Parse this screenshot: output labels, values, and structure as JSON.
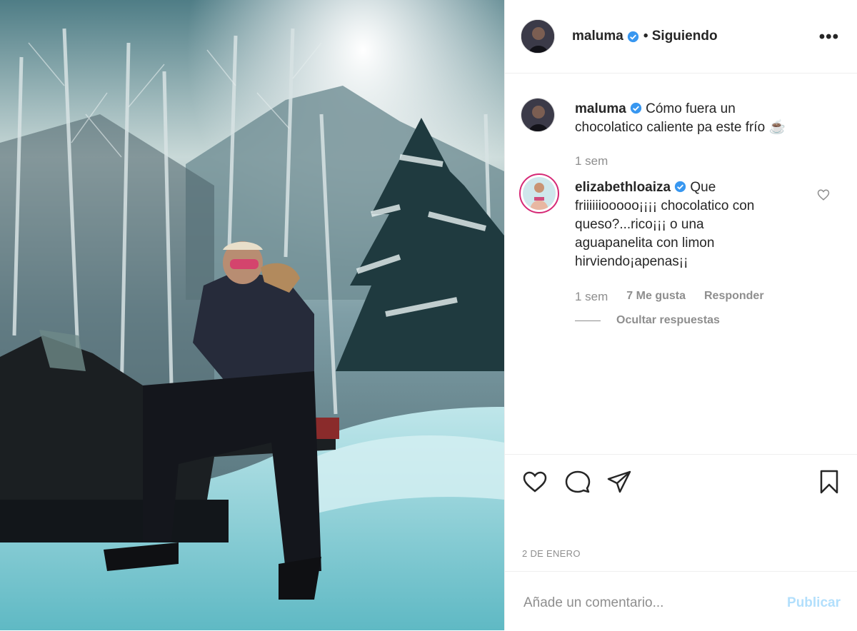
{
  "post": {
    "username": "maluma",
    "following_label": "• Siguiendo",
    "more_label": "•••"
  },
  "caption": {
    "username": "maluma",
    "text_line1": "Cómo fuera un",
    "text_line2": "chocolatico caliente pa este frío",
    "emoji": "☕",
    "time": "1 sem"
  },
  "reply": {
    "username": "elizabethloaiza",
    "text_line1_rest": "Que",
    "text_line2": "friiiiiiooooo¡¡¡¡ chocolatico con",
    "text_line3": "queso?...rico¡¡¡ o una",
    "text_line4": "aguapanelita con limon",
    "text_line5": "hirviendo¡apenas¡¡",
    "time": "1 sem",
    "likes": "7 Me gusta",
    "reply_label": "Responder",
    "hide_replies": "Ocultar respuestas"
  },
  "date": "2 DE ENERO",
  "add_comment": {
    "placeholder": "Añade un comentario...",
    "publish_label": "Publicar"
  },
  "colors": {
    "verified": "#3897f0",
    "publish_disabled": "#b2dffc",
    "meta": "#8e8e8e"
  },
  "icons": [
    "verified-icon",
    "more-icon",
    "heart-icon",
    "comment-icon",
    "share-icon",
    "bookmark-icon"
  ]
}
